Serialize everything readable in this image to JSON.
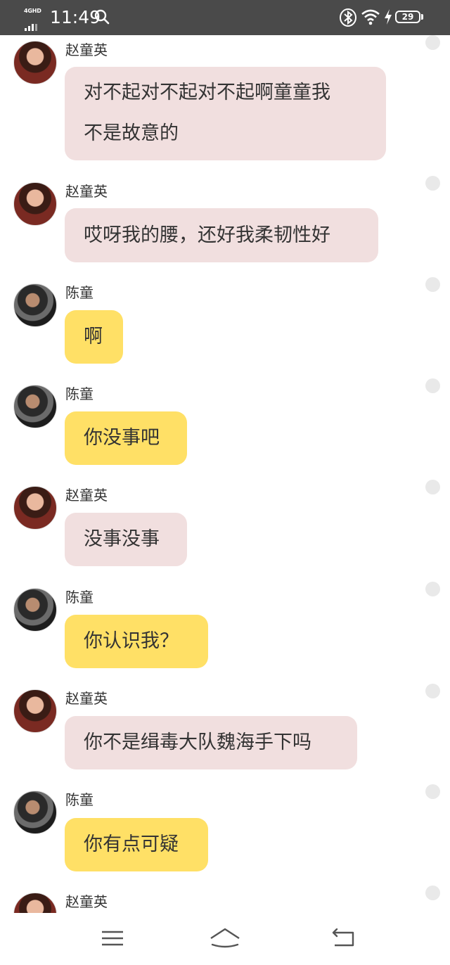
{
  "status_bar": {
    "network": "4GHD",
    "time": "11:49",
    "battery": "29"
  },
  "contacts": {
    "female": "赵童英",
    "male": "陈童"
  },
  "messages": [
    {
      "sender": "赵童英",
      "lines": [
        "对不起对不起对不起啊童童我",
        "不是故意的"
      ]
    },
    {
      "sender": "赵童英",
      "lines": [
        "哎呀我的腰，还好我柔韧性好"
      ]
    },
    {
      "sender": "陈童",
      "lines": [
        "啊"
      ]
    },
    {
      "sender": "陈童",
      "lines": [
        "你没事吧"
      ]
    },
    {
      "sender": "赵童英",
      "lines": [
        "没事没事"
      ]
    },
    {
      "sender": "陈童",
      "lines": [
        "你认识我？"
      ]
    },
    {
      "sender": "赵童英",
      "lines": [
        "你不是缉毒大队魏海手下吗"
      ]
    },
    {
      "sender": "陈童",
      "lines": [
        "你有点可疑"
      ]
    },
    {
      "sender": "赵童英",
      "lines": []
    }
  ],
  "colors": {
    "status_bar_bg": "#4a4a4a",
    "female_bubble": "#f1dfdf",
    "male_bubble": "#ffe066",
    "text": "#333333"
  },
  "icons": [
    "signal-icon",
    "search-icon",
    "bluetooth-icon",
    "wifi-icon",
    "charging-icon",
    "battery-icon",
    "menu-icon",
    "home-icon",
    "back-icon",
    "avatar"
  ]
}
